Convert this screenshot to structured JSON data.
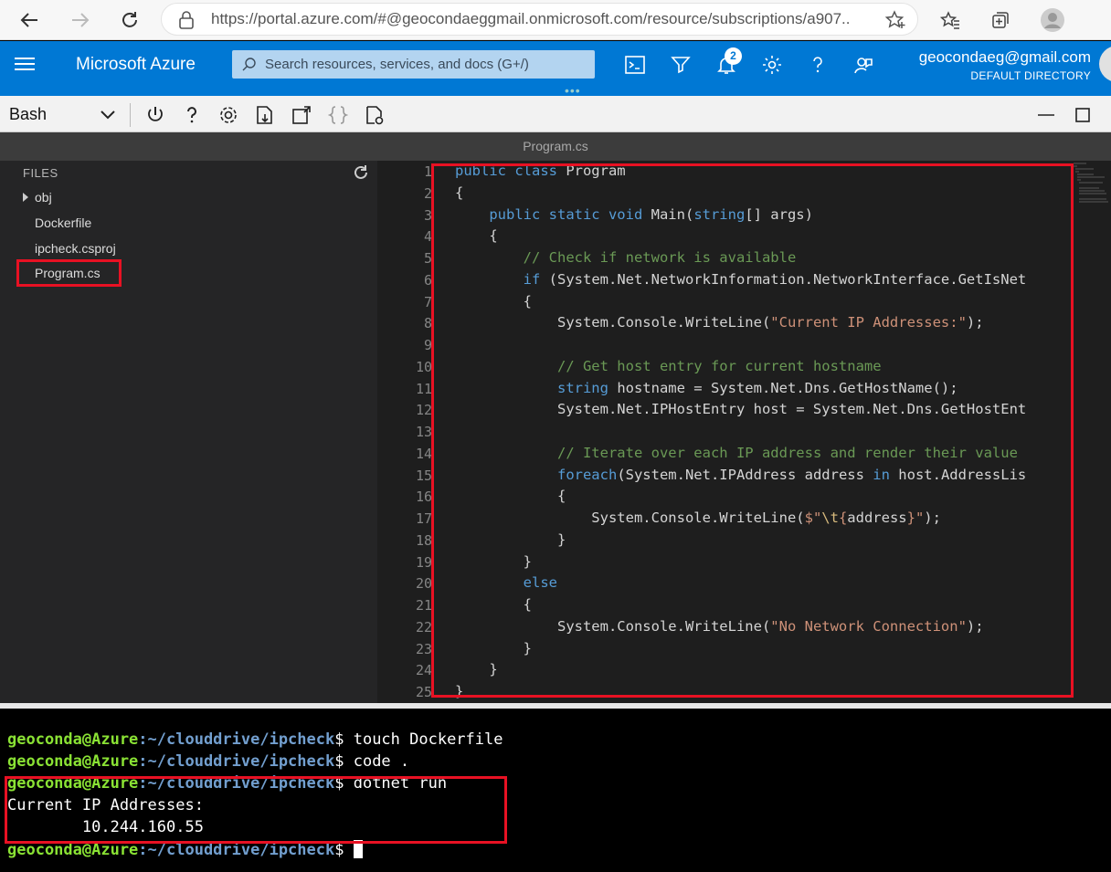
{
  "browser": {
    "url": "https://portal.azure.com/#@geocondaeggmail.onmicrosoft.com/resource/subscriptions/a907..."
  },
  "azure": {
    "brand": "Microsoft Azure",
    "search_placeholder": "Search resources, services, and docs (G+/)",
    "notification_count": "2",
    "user_email": "geocondaeg@gmail.com",
    "user_directory": "DEFAULT DIRECTORY",
    "accent_color": "#0078d4"
  },
  "shell": {
    "type": "Bash"
  },
  "editor": {
    "title": "Program.cs",
    "line_numbers": [
      "1",
      "2",
      "3",
      "4",
      "5",
      "6",
      "7",
      "8",
      "9",
      "10",
      "11",
      "12",
      "13",
      "14",
      "15",
      "16",
      "17",
      "18",
      "19",
      "20",
      "21",
      "22",
      "23",
      "24",
      "25"
    ]
  },
  "explorer": {
    "header": "FILES",
    "items": [
      {
        "label": "obj"
      },
      {
        "label": "Dockerfile"
      },
      {
        "label": "ipcheck.csproj"
      },
      {
        "label": "Program.cs"
      }
    ]
  },
  "code": {
    "l1_a": "public class",
    "l1_b": " Program",
    "l2": "{",
    "l3_a": "    ",
    "l3_kw": "public static void",
    "l3_b": " Main(",
    "l3_kw2": "string",
    "l3_c": "[] args)",
    "l4": "    {",
    "l5_a": "        ",
    "l5_cm": "// Check if network is available",
    "l6_a": "        ",
    "l6_kw": "if",
    "l6_b": " (System.Net.NetworkInformation.NetworkInterface.GetIsNet",
    "l7": "        {",
    "l8_a": "            System.Console.WriteLine(",
    "l8_st": "\"Current IP Addresses:\"",
    "l8_b": ");",
    "l9": "",
    "l10_a": "            ",
    "l10_cm": "// Get host entry for current hostname",
    "l11_a": "            ",
    "l11_kw": "string",
    "l11_b": " hostname = System.Net.Dns.GetHostName();",
    "l12": "            System.Net.IPHostEntry host = System.Net.Dns.GetHostEnt",
    "l13": "",
    "l14_a": "            ",
    "l14_cm": "// Iterate over each IP address and render their value",
    "l15_a": "            ",
    "l15_kw": "foreach",
    "l15_b": "(System.Net.IPAddress address ",
    "l15_kw2": "in",
    "l15_c": " host.AddressLis",
    "l16": "            {",
    "l17_a": "                System.Console.WriteLine(",
    "l17_st1": "$\"",
    "l17_esc": "\\t",
    "l17_st2": "{",
    "l17_b": "address",
    "l17_st3": "}\"",
    "l17_c": ");",
    "l18": "            }",
    "l19": "        }",
    "l20_a": "        ",
    "l20_kw": "else",
    "l21": "        {",
    "l22_a": "            System.Console.WriteLine(",
    "l22_st": "\"No Network Connection\"",
    "l22_b": ");",
    "l23": "        }",
    "l24": "    }",
    "l25": "}"
  },
  "terminal": {
    "prompt_user": "geoconda@Azure",
    "prompt_path": ":~/clouddrive/ipcheck",
    "prompt_symbol": "$",
    "lines": [
      {
        "cmd": " touch Dockerfile"
      },
      {
        "cmd": " code ."
      },
      {
        "cmd": " dotnet run"
      }
    ],
    "output1": "Current IP Addresses:",
    "output2": "        10.244.160.55"
  }
}
